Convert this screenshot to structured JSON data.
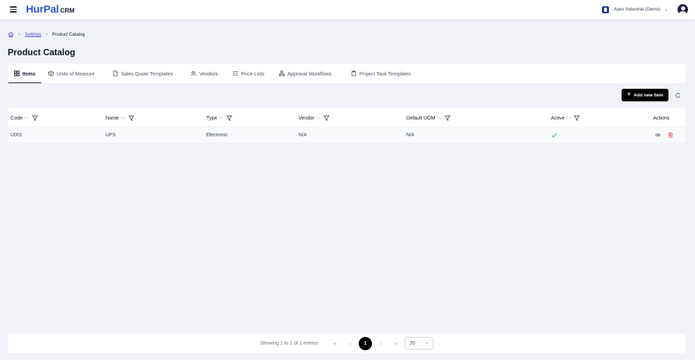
{
  "header": {
    "logo_main": "HurPal",
    "logo_suffix": "CRM",
    "organization": "Apex Industrial (Demo)"
  },
  "breadcrumb": {
    "items": [
      "Settings",
      "Product Catalog"
    ]
  },
  "page": {
    "title": "Product Catalog"
  },
  "tabs": [
    {
      "label": "Items",
      "icon": "grid-icon",
      "active": true
    },
    {
      "label": "Units of Measure",
      "icon": "cube-icon",
      "active": false
    },
    {
      "label": "Sales Quote Templates",
      "icon": "document-icon",
      "active": false
    },
    {
      "label": "Vendors",
      "icon": "users-icon",
      "active": false
    },
    {
      "label": "Price Lists",
      "icon": "list-icon",
      "active": false
    },
    {
      "label": "Approval Workflows",
      "icon": "workflow-icon",
      "active": false
    },
    {
      "label": "Project Task Templates",
      "icon": "clipboard-icon",
      "active": false
    }
  ],
  "toolbar": {
    "add_label": "Add new Item"
  },
  "table": {
    "columns": [
      "Code",
      "Name",
      "Type",
      "Vendor",
      "Default UOM",
      "Active",
      "Actions"
    ],
    "rows": [
      {
        "code": "U001",
        "name": "UPS",
        "type": "Electronic",
        "vendor": "N/A",
        "uom": "N/A",
        "active": true
      }
    ]
  },
  "pagination": {
    "summary": "Showing 1 to 1 of 1 entries",
    "current_page": "1",
    "page_size": "20"
  },
  "colors": {
    "brand": "#2f55d4",
    "accent": "#000000",
    "active_check": "#22c55e",
    "delete": "#ef4444"
  }
}
